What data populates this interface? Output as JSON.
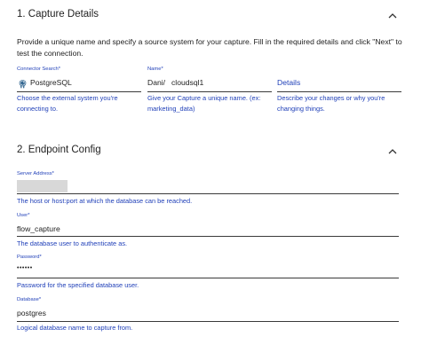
{
  "capture_details": {
    "title": "1. Capture Details",
    "description": "Provide a unique name and specify a source system for your capture. Fill in the required details and click \"Next\" to test the connection.",
    "connector_search": {
      "label": "Connector Search",
      "required_mark": "*",
      "value": "PostgreSQL",
      "icon": "postgresql-elephant-icon",
      "helper": "Choose the external system you're connecting to."
    },
    "name": {
      "label": "Name",
      "required_mark": "*",
      "prefix": "Dani/",
      "value": "cloudsql1",
      "helper": "Give your Capture a unique name. (ex: marketing_data)"
    },
    "details": {
      "placeholder": "Details",
      "helper": "Describe your changes or why you're changing things."
    }
  },
  "endpoint_config": {
    "title": "2. Endpoint Config",
    "server_address": {
      "label": "Server Address",
      "required_mark": "*",
      "helper": "The host or host:port at which the database can be reached."
    },
    "user": {
      "label": "User",
      "required_mark": "*",
      "value": "flow_capture",
      "helper": "The database user to authenticate as."
    },
    "password": {
      "label": "Password",
      "required_mark": "*",
      "value": "••••••",
      "helper": "Password for the specified database user."
    },
    "database": {
      "label": "Database",
      "required_mark": "*",
      "value": "postgres",
      "helper": "Logical database name to capture from."
    }
  },
  "colors": {
    "accent": "#1f3fb8",
    "text": "#222222",
    "underline": "#3a3a3a",
    "masked_fill": "#d8d8d8"
  }
}
